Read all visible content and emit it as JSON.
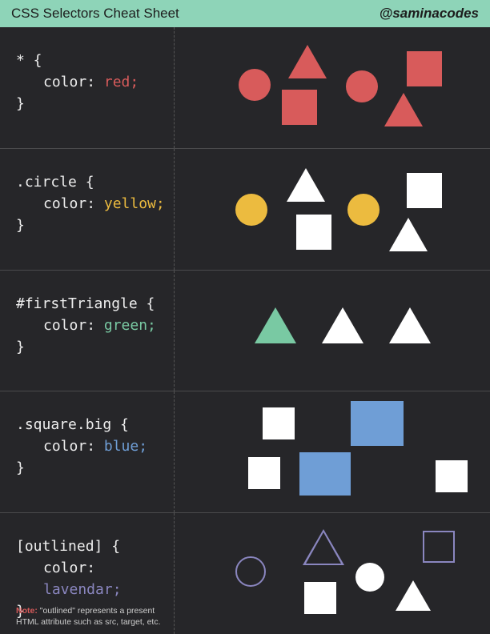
{
  "header": {
    "title": "CSS Selectors Cheat Sheet",
    "handle": "@saminacodes"
  },
  "rows": [
    {
      "selector": "* {",
      "prop": "color",
      "value": "red;",
      "valueColor": "#d85b5b",
      "close": "}"
    },
    {
      "selector": ".circle {",
      "prop": "color",
      "value": "yellow;",
      "valueColor": "#ecbb3f",
      "close": "}"
    },
    {
      "selector": "#firstTriangle {",
      "prop": "color",
      "value": "green;",
      "valueColor": "#79c9a3",
      "close": "}"
    },
    {
      "selector": ".square.big {",
      "prop": "color",
      "value": "blue;",
      "valueColor": "#6f9ed6",
      "close": "}"
    },
    {
      "selector": "[outlined] {",
      "prop": "color",
      "value": "lavendar;",
      "valueColor": "#8a86bf",
      "close": "}"
    }
  ],
  "note": {
    "label": "Note:",
    "text": " \"outlined\" represents a present HTML attribute such as src, target, etc."
  },
  "propLabel": ": "
}
